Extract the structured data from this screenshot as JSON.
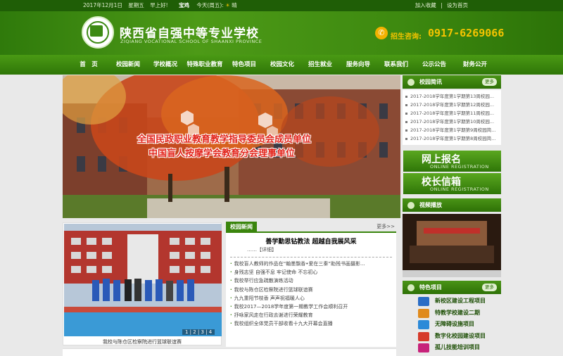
{
  "topbar": {
    "date": "2017年12月1日",
    "weekday": "星期五",
    "greeting": "早上好!",
    "city": "宝鸡",
    "today": "今天(周五):",
    "weather": "晴",
    "favorite": "加入收藏",
    "homepage": "设为首页",
    "separator": "|"
  },
  "header": {
    "school_name": "陕西省自强中等专业学校",
    "school_en": "ZIQIANG VOCATIONAL SCHOOL OF SHAANXI PROVINCE",
    "phone_label": "招生咨询:",
    "phone": "0917-6269066"
  },
  "nav": [
    "首　页",
    "校园新闻",
    "学校概况",
    "特殊职业教育",
    "特色项目",
    "校园文化",
    "招生就业",
    "服务向导",
    "联系我们",
    "公示公告",
    "财务公开"
  ],
  "banner": {
    "line1": "全国民政职业教育教学指导委员会成员单位",
    "line2": "中国盲人按摩学会教育分会理事单位"
  },
  "side": {
    "news_title": "校园简讯",
    "more": "更多",
    "news": [
      "2017-2018学年度第1学期第13周校园...",
      "2017-2018学年度第1学期第12周校园...",
      "2017-2018学年度第1学期第11周校园...",
      "2017-2018学年度第1学期第10周校园...",
      "2017-2018学年度第1学期第9周校园简...",
      "2017-2018学年度第1学期第8周校园简..."
    ],
    "online_cn": "网上报名",
    "online_en": "ONLINE REGISTRATION",
    "mailbox_cn": "校长信箱",
    "mailbox_en": "ONLINE REGISTRATION",
    "video_title": "视频播放",
    "feature_title": "特色项目",
    "features": [
      "新校区建设工程项目",
      "特教学校建设二期",
      "无障碍设施项目",
      "数字化校园建设项目",
      "孤儿技能培训项目"
    ]
  },
  "photo": {
    "caption": "我校与陈仓区检察院进行篮球联谊赛",
    "pager": "1 | 2 | 3 | 4"
  },
  "news_panel": {
    "tab": "校园新闻",
    "more": "更多>>",
    "headline": "善学勤思钻教法 超越自我展风采",
    "detail": "……【详细】",
    "items": [
      "我校盲人教师的作品在“翰墨飘香•爱在三秦”助残书画摄影...",
      "身残志坚 自强不息 牢记使命 不忘初心",
      "我校举行应急疏散演练活动",
      "我校与陈仓区检察院进行篮球联谊赛",
      "九九重阳节枝香 声声祝福暖人心",
      "我校2017—2018学年度第一期教学工作会顺利召开",
      "抒咏家风走在行政去谢进行荣耀教育",
      "我校组织全体党员干部收看十九大开幕会直播"
    ]
  },
  "colors": {
    "brand_green": "#3a850d",
    "dark_green": "#1f5e06",
    "phone_yellow": "#f5c400",
    "banner_red": "#e2231a"
  }
}
